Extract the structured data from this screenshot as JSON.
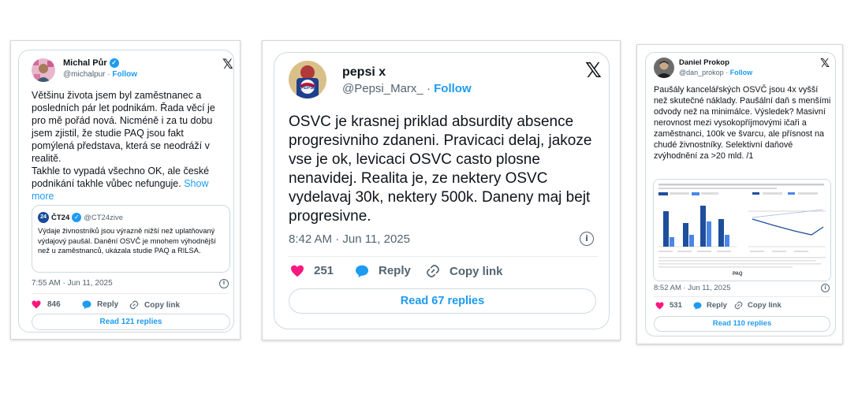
{
  "colors": {
    "accent": "#1d9bf0",
    "like": "#f91880",
    "text": "#0f1419",
    "muted": "#536471"
  },
  "cards": [
    {
      "author": {
        "name": "Michal Půr",
        "verified": true,
        "handle": "@michalpur",
        "follow": "Follow"
      },
      "text": "Většinu života jsem byl zaměstnanec a posledních pár let podnikám. Řada věcí je pro mě pořád nová. Nicméně i za tu dobu jsem zjistil, že studie PAQ jsou fakt pomýlená představa, která se neodráží v realitě.\nTakhle to vypadá všechno OK, ale české podnikání takhle vůbec nefunguje.",
      "show_more": "Show more",
      "quote": {
        "badge": "24",
        "name": "ČT24",
        "verified": true,
        "handle": "@CT24zive",
        "text": "Výdaje živnostníků jsou výrazně nižší než uplatňovaný výdajový paušál. Danění OSVČ je mnohem výhodnější než u zaměstnanců, ukázala studie PAQ a RILSA."
      },
      "timestamp": "7:55 AM · Jun 11, 2025",
      "likes": "846",
      "reply": "Reply",
      "copy_link": "Copy link",
      "read_replies": "Read 121 replies"
    },
    {
      "author": {
        "name": "pepsi x",
        "verified": false,
        "handle": "@Pepsi_Marx_",
        "follow": "Follow"
      },
      "text": "OSVC je krasnej priklad absurdity absence progresivniho zdaneni. Pravicaci delaj, jakoze vse je ok, levicaci OSVC casto plosne nenavidej. Realita je, ze nektery OSVC vydelavaj 30k, nektery 500k. Daneny maj bejt progresivne.",
      "timestamp": "8:42 AM · Jun 11, 2025",
      "likes": "251",
      "reply": "Reply",
      "copy_link": "Copy link",
      "read_replies": "Read 67 replies"
    },
    {
      "author": {
        "name": "Daniel Prokop",
        "verified": false,
        "handle": "@dan_prokop",
        "follow": "Follow"
      },
      "text": "Paušály kancelářských OSVČ jsou 4x vyšší než skutečné náklady. Paušální daň s menšími odvody než na minimálce. Výsledek? Masivní nerovnost mezi vysokopříjmovými ičaři a zaměstnanci, 100k ve švarcu, ale přísnost na chudé živnostníky. Selektivní daňové zvýhodnění za >20 mld. /1",
      "embedded_logo": "PAQ",
      "timestamp": "8:52 AM · Jun 11, 2025",
      "likes": "531",
      "reply": "Reply",
      "copy_link": "Copy link",
      "read_replies": "Read 110 replies"
    }
  ]
}
